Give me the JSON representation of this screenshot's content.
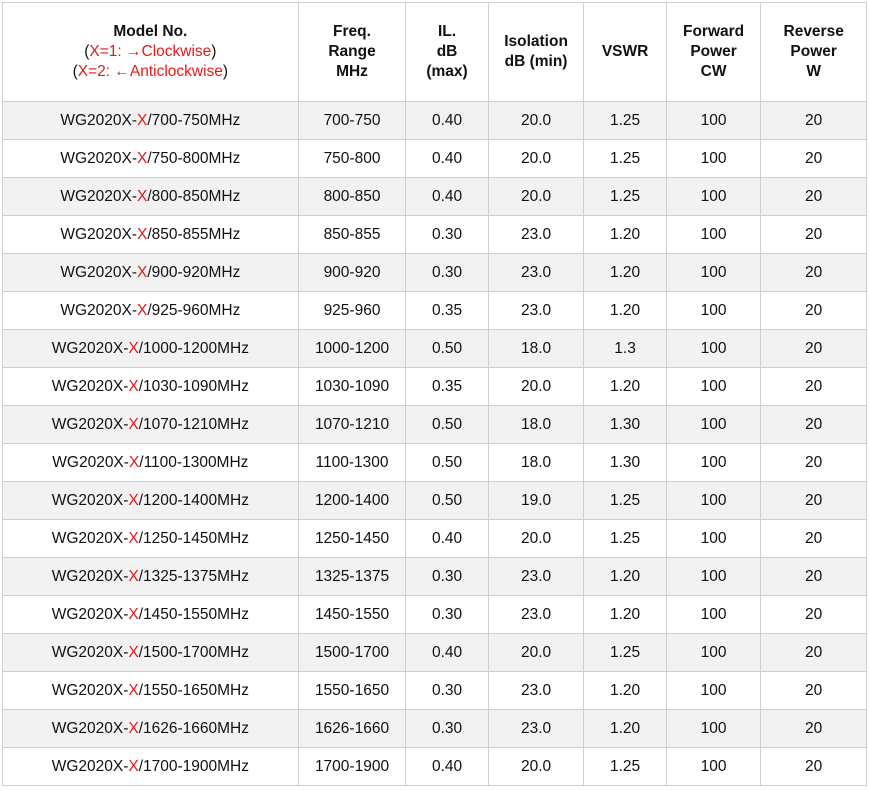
{
  "table": {
    "headers": {
      "model": {
        "title": "Model No.",
        "note1_open": "(",
        "note1_red": "X=1: →Clockwise",
        "note1_close": ")",
        "note2_open": "(",
        "note2_red": "X=2: ←Anticlockwise",
        "note2_close": ")"
      },
      "freq": [
        "Freq.",
        "Range",
        "MHz"
      ],
      "il": [
        "IL.",
        "dB",
        "(max)"
      ],
      "isolation": [
        "Isolation",
        "dB (min)"
      ],
      "vswr": [
        "VSWR"
      ],
      "forward": [
        "Forward",
        "Power",
        "CW"
      ],
      "reverse": [
        "Reverse",
        "Power",
        "W"
      ]
    },
    "rows": [
      {
        "model_prefix": "WG2020X-",
        "model_x": "X",
        "model_suffix": "/700-750MHz",
        "freq": "700-750",
        "il": "0.40",
        "isolation": "20.0",
        "vswr": "1.25",
        "forward": "100",
        "reverse": "20"
      },
      {
        "model_prefix": "WG2020X-",
        "model_x": "X",
        "model_suffix": "/750-800MHz",
        "freq": "750-800",
        "il": "0.40",
        "isolation": "20.0",
        "vswr": "1.25",
        "forward": "100",
        "reverse": "20"
      },
      {
        "model_prefix": "WG2020X-",
        "model_x": "X",
        "model_suffix": "/800-850MHz",
        "freq": "800-850",
        "il": "0.40",
        "isolation": "20.0",
        "vswr": "1.25",
        "forward": "100",
        "reverse": "20"
      },
      {
        "model_prefix": "WG2020X-",
        "model_x": "X",
        "model_suffix": "/850-855MHz",
        "freq": "850-855",
        "il": "0.30",
        "isolation": "23.0",
        "vswr": "1.20",
        "forward": "100",
        "reverse": "20"
      },
      {
        "model_prefix": "WG2020X-",
        "model_x": "X",
        "model_suffix": "/900-920MHz",
        "freq": "900-920",
        "il": "0.30",
        "isolation": "23.0",
        "vswr": "1.20",
        "forward": "100",
        "reverse": "20"
      },
      {
        "model_prefix": "WG2020X-",
        "model_x": "X",
        "model_suffix": "/925-960MHz",
        "freq": "925-960",
        "il": "0.35",
        "isolation": "23.0",
        "vswr": "1.20",
        "forward": "100",
        "reverse": "20"
      },
      {
        "model_prefix": "WG2020X-",
        "model_x": "X",
        "model_suffix": "/1000-1200MHz",
        "freq": "1000-1200",
        "il": "0.50",
        "isolation": "18.0",
        "vswr": "1.3",
        "forward": "100",
        "reverse": "20"
      },
      {
        "model_prefix": "WG2020X-",
        "model_x": "X",
        "model_suffix": "/1030-1090MHz",
        "freq": "1030-1090",
        "il": "0.35",
        "isolation": "20.0",
        "vswr": "1.20",
        "forward": "100",
        "reverse": "20"
      },
      {
        "model_prefix": "WG2020X-",
        "model_x": "X",
        "model_suffix": "/1070-1210MHz",
        "freq": "1070-1210",
        "il": "0.50",
        "isolation": "18.0",
        "vswr": "1.30",
        "forward": "100",
        "reverse": "20"
      },
      {
        "model_prefix": "WG2020X-",
        "model_x": "X",
        "model_suffix": "/1100-1300MHz",
        "freq": "1100-1300",
        "il": "0.50",
        "isolation": "18.0",
        "vswr": "1.30",
        "forward": "100",
        "reverse": "20"
      },
      {
        "model_prefix": "WG2020X-",
        "model_x": "X",
        "model_suffix": "/1200-1400MHz",
        "freq": "1200-1400",
        "il": "0.50",
        "isolation": "19.0",
        "vswr": "1.25",
        "forward": "100",
        "reverse": "20"
      },
      {
        "model_prefix": "WG2020X-",
        "model_x": "X",
        "model_suffix": "/1250-1450MHz",
        "freq": "1250-1450",
        "il": "0.40",
        "isolation": "20.0",
        "vswr": "1.25",
        "forward": "100",
        "reverse": "20"
      },
      {
        "model_prefix": "WG2020X-",
        "model_x": "X",
        "model_suffix": "/1325-1375MHz",
        "freq": "1325-1375",
        "il": "0.30",
        "isolation": "23.0",
        "vswr": "1.20",
        "forward": "100",
        "reverse": "20"
      },
      {
        "model_prefix": "WG2020X-",
        "model_x": "X",
        "model_suffix": "/1450-1550MHz",
        "freq": "1450-1550",
        "il": "0.30",
        "isolation": "23.0",
        "vswr": "1.20",
        "forward": "100",
        "reverse": "20"
      },
      {
        "model_prefix": "WG2020X-",
        "model_x": "X",
        "model_suffix": "/1500-1700MHz",
        "freq": "1500-1700",
        "il": "0.40",
        "isolation": "20.0",
        "vswr": "1.25",
        "forward": "100",
        "reverse": "20"
      },
      {
        "model_prefix": "WG2020X-",
        "model_x": "X",
        "model_suffix": "/1550-1650MHz",
        "freq": "1550-1650",
        "il": "0.30",
        "isolation": "23.0",
        "vswr": "1.20",
        "forward": "100",
        "reverse": "20"
      },
      {
        "model_prefix": "WG2020X-",
        "model_x": "X",
        "model_suffix": "/1626-1660MHz",
        "freq": "1626-1660",
        "il": "0.30",
        "isolation": "23.0",
        "vswr": "1.20",
        "forward": "100",
        "reverse": "20"
      },
      {
        "model_prefix": "WG2020X-",
        "model_x": "X",
        "model_suffix": "/1700-1900MHz",
        "freq": "1700-1900",
        "il": "0.40",
        "isolation": "20.0",
        "vswr": "1.25",
        "forward": "100",
        "reverse": "20"
      }
    ]
  },
  "colors": {
    "highlight_red": "#e11b1b",
    "row_alt": "#f2f2f2",
    "border": "#cfcfcf"
  }
}
